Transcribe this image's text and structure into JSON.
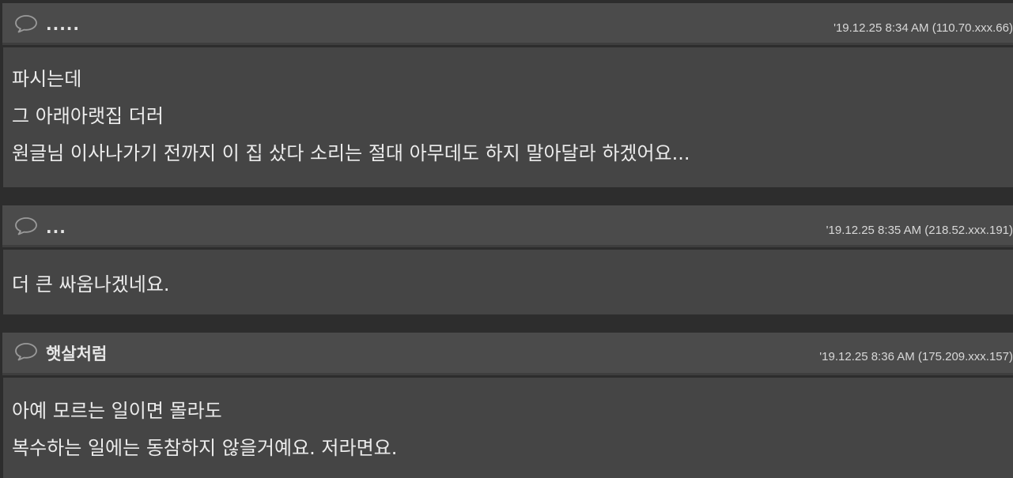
{
  "comments": [
    {
      "nickname": ".....",
      "meta": "'19.12.25 8:34 AM  (110.70.xxx.66)",
      "lines": [
        "파시는데",
        "그 아래아랫집 더러",
        "원글님 이사나가기 전까지 이 집 샀다 소리는 절대 아무데도 하지 말아달라 하겠어요..."
      ]
    },
    {
      "nickname": "...",
      "meta": "'19.12.25 8:35 AM  (218.52.xxx.191)",
      "lines": [
        "더 큰 싸움나겠네요."
      ]
    },
    {
      "nickname": "햇살처럼",
      "meta": "'19.12.25 8:36 AM  (175.209.xxx.157)",
      "lines": [
        "아예 모르는 일이면 몰라도",
        "복수하는 일에는 동참하지 않을거예요. 저라면요."
      ]
    }
  ],
  "icons": {
    "comment": "speech-bubble-icon"
  },
  "colors": {
    "page_bg": "#2d2d2d",
    "header_bg": "#4b4b4b",
    "body_bg": "#454545",
    "text": "#ececec"
  }
}
